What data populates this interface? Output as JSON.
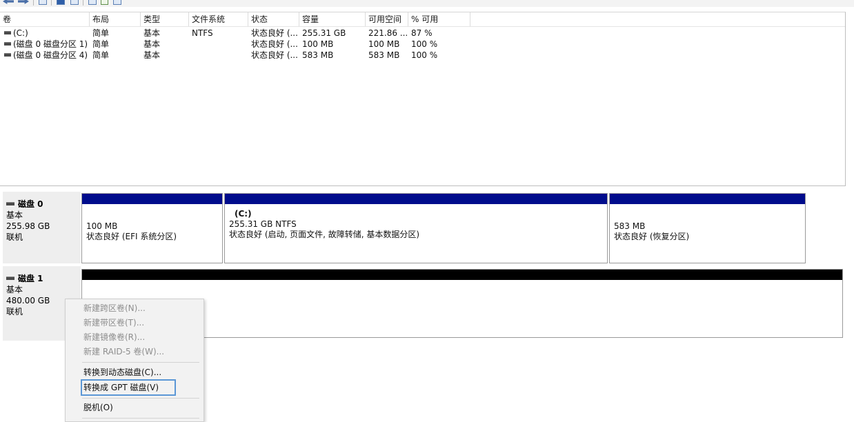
{
  "toolbar": {
    "icons": [
      "back-arrow-icon",
      "forward-arrow-icon",
      "disk-view-icon",
      "help-icon",
      "refresh-icon",
      "properties-icon",
      "check-icon",
      "settings-icon"
    ]
  },
  "volume_list": {
    "columns": [
      "卷",
      "布局",
      "类型",
      "文件系统",
      "状态",
      "容量",
      "可用空间",
      "% 可用"
    ],
    "rows": [
      {
        "volume": "(C:)",
        "layout": "简单",
        "type": "基本",
        "fs": "NTFS",
        "status": "状态良好 (...",
        "capacity": "255.31 GB",
        "free": "221.86 ...",
        "pct": "87 %"
      },
      {
        "volume": "(磁盘 0 磁盘分区 1)",
        "layout": "简单",
        "type": "基本",
        "fs": "",
        "status": "状态良好 (...",
        "capacity": "100 MB",
        "free": "100 MB",
        "pct": "100 %"
      },
      {
        "volume": "(磁盘 0 磁盘分区 4)",
        "layout": "简单",
        "type": "基本",
        "fs": "",
        "status": "状态良好 (...",
        "capacity": "583 MB",
        "free": "583 MB",
        "pct": "100 %"
      }
    ]
  },
  "disks": [
    {
      "name": "磁盘 0",
      "type": "基本",
      "size": "255.98 GB",
      "state": "联机",
      "partitions": [
        {
          "name": "",
          "size": "100 MB",
          "status": "状态良好 (EFI 系统分区)"
        },
        {
          "name": "(C:)",
          "size": "255.31 GB NTFS",
          "status": "状态良好 (启动, 页面文件, 故障转储, 基本数据分区)"
        },
        {
          "name": "",
          "size": "583 MB",
          "status": "状态良好 (恢复分区)"
        }
      ]
    },
    {
      "name": "磁盘 1",
      "type": "基本",
      "size": "480.00 GB",
      "state": "联机"
    }
  ],
  "context_menu": {
    "items": [
      {
        "label": "新建跨区卷(N)...",
        "enabled": false
      },
      {
        "label": "新建带区卷(T)...",
        "enabled": false
      },
      {
        "label": "新建镜像卷(R)...",
        "enabled": false
      },
      {
        "label": "新建 RAID-5 卷(W)...",
        "enabled": false
      },
      {
        "label": "转换到动态磁盘(C)...",
        "enabled": true
      },
      {
        "label": "转换成 GPT 磁盘(V)",
        "enabled": true,
        "highlighted": true
      },
      {
        "label": "脱机(O)",
        "enabled": true
      }
    ]
  },
  "colors": {
    "partition_bar": "#000c8c",
    "unallocated_bar": "#000000",
    "highlight_border": "#5b97d6"
  }
}
